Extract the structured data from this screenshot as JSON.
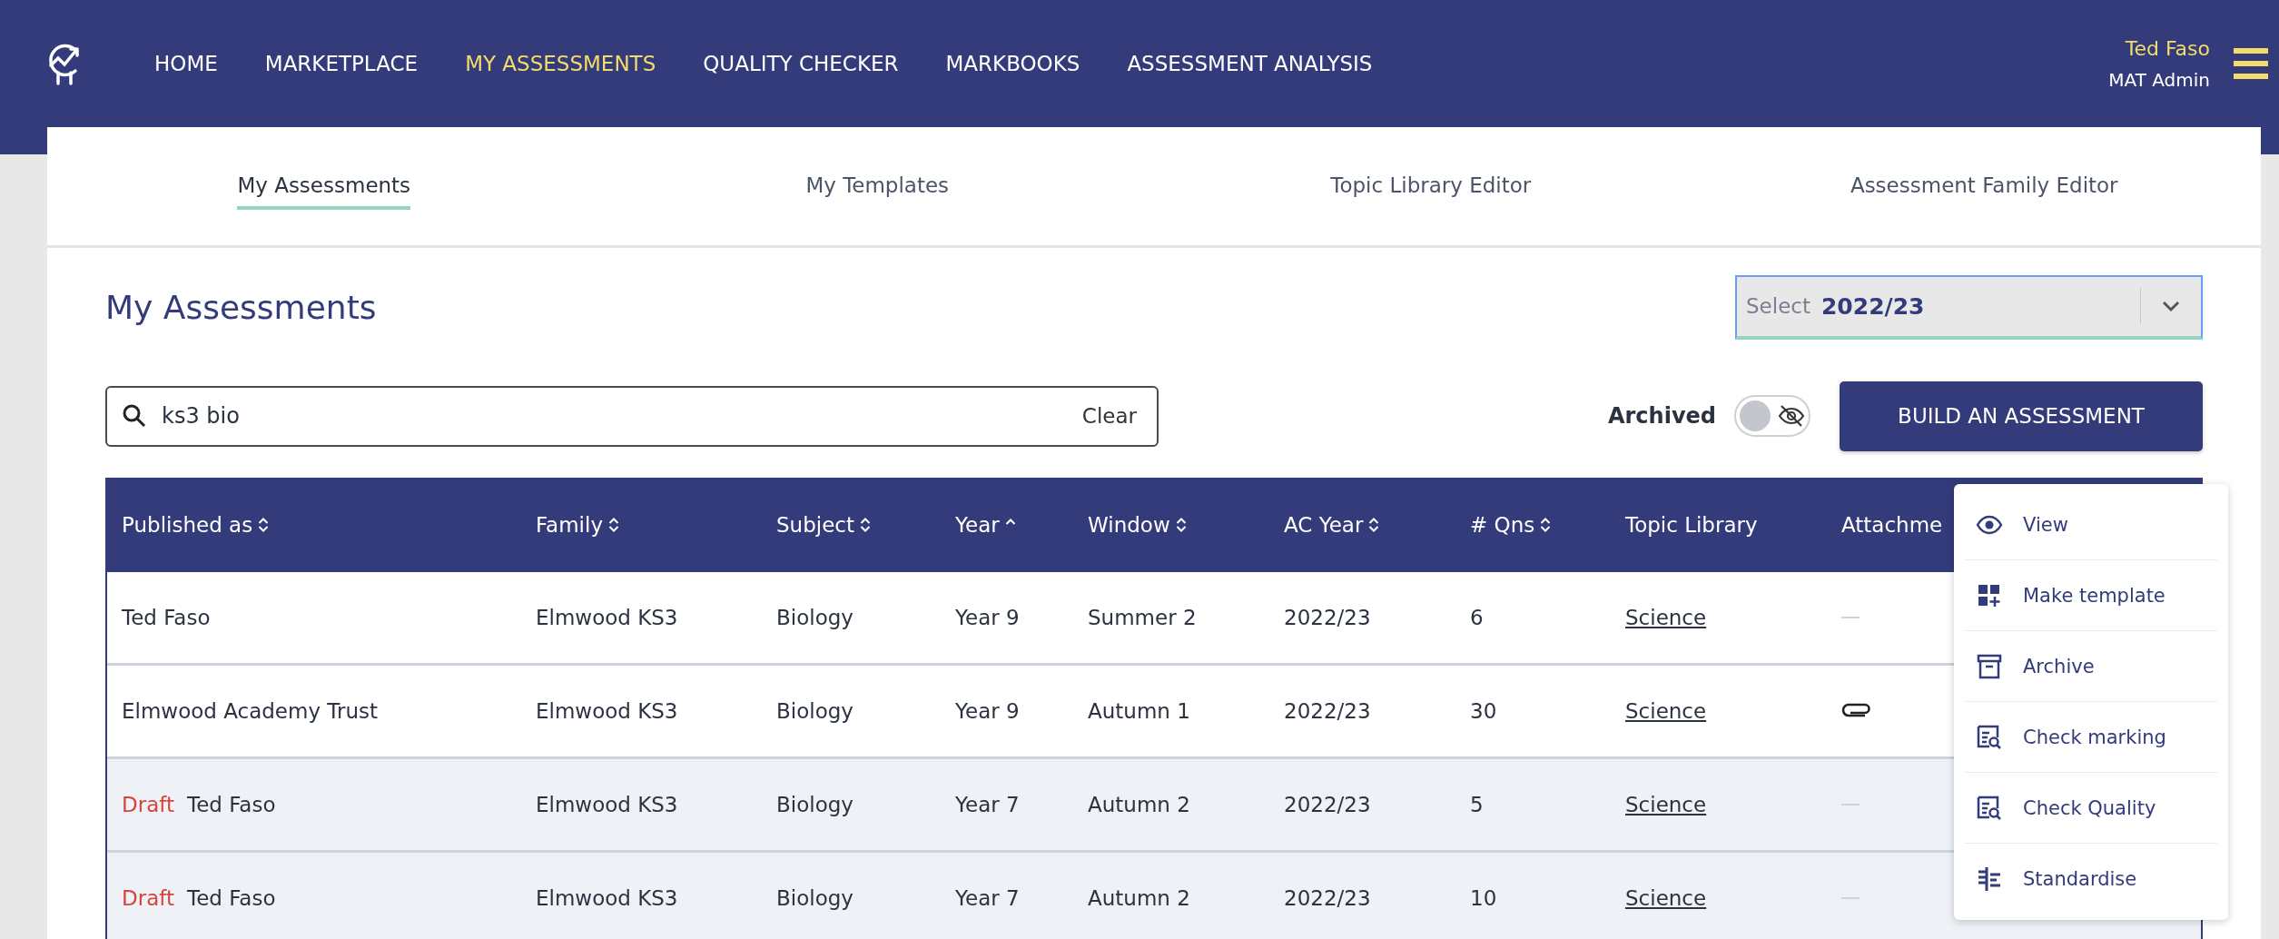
{
  "nav": {
    "items": [
      {
        "label": "HOME",
        "selected": false
      },
      {
        "label": "MARKETPLACE",
        "selected": false
      },
      {
        "label": "MY ASSESSMENTS",
        "selected": true
      },
      {
        "label": "QUALITY CHECKER",
        "selected": false
      },
      {
        "label": "MARKBOOKS",
        "selected": false
      },
      {
        "label": "ASSESSMENT ANALYSIS",
        "selected": false
      }
    ],
    "user": {
      "name": "Ted Faso",
      "role": "MAT Admin"
    }
  },
  "tabs": [
    {
      "label": "My Assessments",
      "selected": true
    },
    {
      "label": "My Templates",
      "selected": false
    },
    {
      "label": "Topic Library Editor",
      "selected": false
    },
    {
      "label": "Assessment Family Editor",
      "selected": false
    }
  ],
  "page_title": "My Assessments",
  "year_select": {
    "label": "Select",
    "value": "2022/23"
  },
  "search": {
    "value": "ks3 bio",
    "clear": "Clear"
  },
  "archived": {
    "label": "Archived",
    "on": false
  },
  "build_button": "BUILD AN ASSESSMENT",
  "table": {
    "columns": [
      {
        "label": "Published as",
        "sortable": true,
        "sorted": false
      },
      {
        "label": "Family",
        "sortable": true,
        "sorted": false
      },
      {
        "label": "Subject",
        "sortable": true,
        "sorted": false
      },
      {
        "label": "Year",
        "sortable": true,
        "sorted": true
      },
      {
        "label": "Window",
        "sortable": true,
        "sorted": false
      },
      {
        "label": "AC Year",
        "sortable": true,
        "sorted": false
      },
      {
        "label": "# Qns",
        "sortable": true,
        "sorted": false
      },
      {
        "label": "Topic Library",
        "sortable": false
      },
      {
        "label": "Attachme",
        "sortable": false
      }
    ],
    "rows": [
      {
        "draft": null,
        "published": "Ted Faso",
        "family": "Elmwood KS3",
        "subject": "Biology",
        "year": "Year 9",
        "window": "Summer 2",
        "ac_year": "2022/23",
        "qns": "6",
        "topic": "Science",
        "attachment": false
      },
      {
        "draft": null,
        "published": "Elmwood Academy Trust",
        "family": "Elmwood KS3",
        "subject": "Biology",
        "year": "Year 9",
        "window": "Autumn 1",
        "ac_year": "2022/23",
        "qns": "30",
        "topic": "Science",
        "attachment": true
      },
      {
        "draft": "Draft",
        "published": "Ted Faso",
        "family": "Elmwood KS3",
        "subject": "Biology",
        "year": "Year 7",
        "window": "Autumn 2",
        "ac_year": "2022/23",
        "qns": "5",
        "topic": "Science",
        "attachment": false
      },
      {
        "draft": "Draft",
        "published": "Ted Faso",
        "family": "Elmwood KS3",
        "subject": "Biology",
        "year": "Year 7",
        "window": "Autumn 2",
        "ac_year": "2022/23",
        "qns": "10",
        "topic": "Science",
        "attachment": false
      }
    ]
  },
  "action_menu": [
    {
      "kind": "view",
      "label": "View"
    },
    {
      "kind": "template",
      "label": "Make template"
    },
    {
      "kind": "archive",
      "label": "Archive"
    },
    {
      "kind": "check",
      "label": "Check marking"
    },
    {
      "kind": "check",
      "label": "Check Quality"
    },
    {
      "kind": "standardise",
      "label": "Standardise"
    }
  ]
}
